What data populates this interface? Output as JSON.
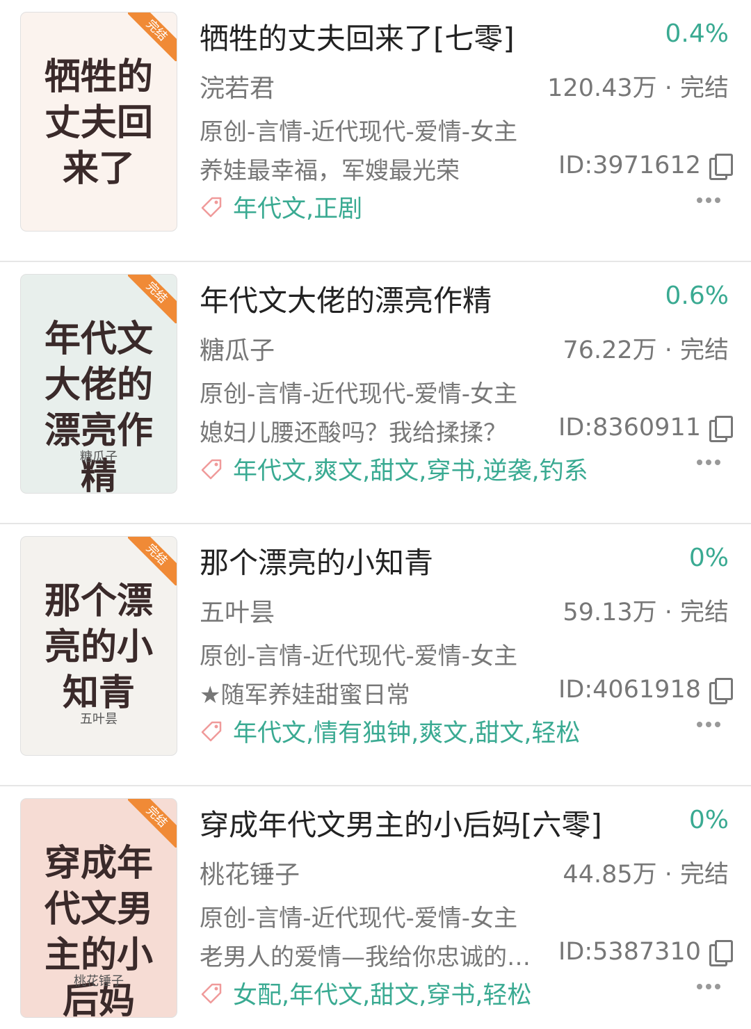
{
  "books": [
    {
      "title": "牺牲的丈夫回来了[七零]",
      "progress": "0.4%",
      "author": "浣若君",
      "word_count": "120.43万 · 完结",
      "category": "原创-言情-近代现代-爱情-女主",
      "blurb": "养娃最幸福，军嫂最光荣",
      "book_id": "ID:3971612",
      "tags": "年代文,正剧",
      "cover_title": "牺牲的丈夫回来了",
      "cover_author": "",
      "badge": "完结",
      "cover_color": "#fbf3ee"
    },
    {
      "title": "年代文大佬的漂亮作精",
      "progress": "0.6%",
      "author": "糖瓜子",
      "word_count": "76.22万 · 完结",
      "category": "原创-言情-近代现代-爱情-女主",
      "blurb": "媳妇儿腰还酸吗？我给揉揉？",
      "book_id": "ID:8360911",
      "tags": "年代文,爽文,甜文,穿书,逆袭,钓系",
      "cover_title": "年代文大佬的漂亮作精",
      "cover_author": "糖瓜子",
      "badge": "完结",
      "cover_color": "#e8efec"
    },
    {
      "title": "那个漂亮的小知青",
      "progress": "0%",
      "author": "五叶昙",
      "word_count": "59.13万 · 完结",
      "category": "原创-言情-近代现代-爱情-女主",
      "blurb": "★随军养娃甜蜜日常",
      "book_id": "ID:4061918",
      "tags": "年代文,情有独钟,爽文,甜文,轻松",
      "cover_title": "那个漂亮的小知青",
      "cover_author": "五叶昙",
      "badge": "完结",
      "cover_color": "#f4f2ee"
    },
    {
      "title": "穿成年代文男主的小后妈[六零]",
      "progress": "0%",
      "author": "桃花锤子",
      "word_count": "44.85万 · 完结",
      "category": "原创-言情-近代现代-爱情-女主",
      "blurb": "老男人的爱情—我给你忠诚的…",
      "book_id": "ID:5387310",
      "tags": "女配,年代文,甜文,穿书,轻松",
      "cover_title": "穿成年代文男主的小后妈",
      "cover_author": "桃花锤子",
      "badge": "完结",
      "cover_color": "#f6dcd4"
    }
  ]
}
